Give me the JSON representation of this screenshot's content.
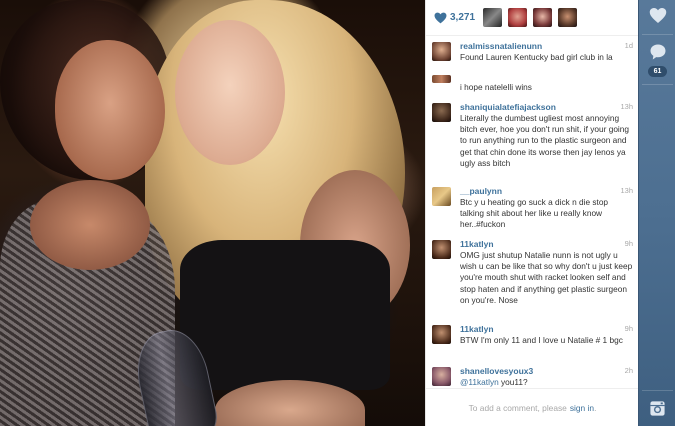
{
  "likes": {
    "count": "3,271"
  },
  "comments": [
    {
      "user": "realmissnatalienunn",
      "time": "1d",
      "text": "Found Lauren Kentucky bad girl club in la"
    },
    {
      "user": "",
      "time": "",
      "text": "i hope natelelli wins"
    },
    {
      "user": "shaniquialatefiajackson",
      "time": "13h",
      "text": "Literally the dumbest ugliest most annoying bitch ever, hoe you don't run shit, if your going to run anything run to the plastic surgeon and get that chin done its worse then jay lenos ya ugly ass bitch"
    },
    {
      "user": "__paulynn",
      "time": "13h",
      "text": "Btc y u heating go suck a dick n die stop talking shit about her like u really know her..#fuckon"
    },
    {
      "user": "11katlyn",
      "time": "9h",
      "text": "OMG just shutup Natalie nunn is not ugly u wish u can be like that so why don't u just keep you're mouth shut with racket looken self and stop haten and if anything get plastic surgeon on you're. Nose"
    },
    {
      "user": "11katlyn",
      "time": "9h",
      "text": "BTW I'm only 11 and I love u Natalie # 1 bgc"
    },
    {
      "user": "shanellovesyoux3",
      "time": "2h",
      "mention": "@11katlyn",
      "text": " you11?"
    }
  ],
  "add_comment": {
    "prefix": "To add a comment, please",
    "link": "sign in",
    "suffix": "."
  },
  "actionbar": {
    "comment_count": "61"
  },
  "colors": {
    "link": "#3f729b",
    "bar": "#517395"
  }
}
